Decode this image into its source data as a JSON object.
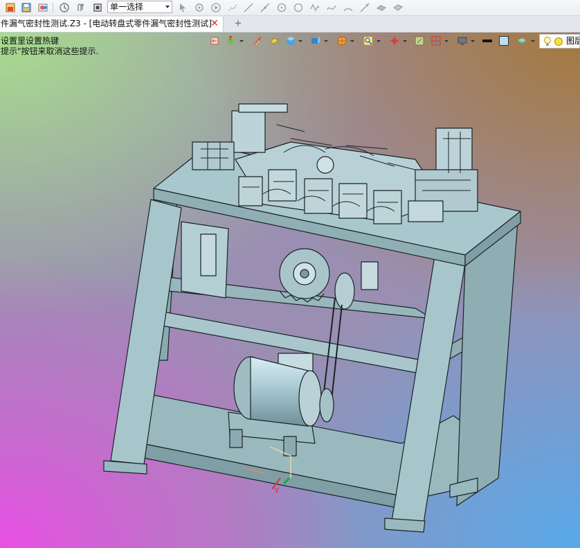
{
  "toolbar": {
    "select_mode": "单一选择"
  },
  "tabs": {
    "active_title": "件漏气密封性测试.Z3 - [电动转盘式零件漏气密封性测试]",
    "close_symbol": "✕",
    "add_symbol": "+"
  },
  "viewport": {
    "hint_line1": "设置里设置热键",
    "hint_line2": "提示\"按钮来取消这些提示.",
    "layer_label": "图层"
  },
  "triad": {
    "y_label": "Y"
  },
  "colors": {
    "model_fill": "#9fc0c6",
    "model_edge": "#1a2226",
    "tab_close": "#c23b2d"
  }
}
